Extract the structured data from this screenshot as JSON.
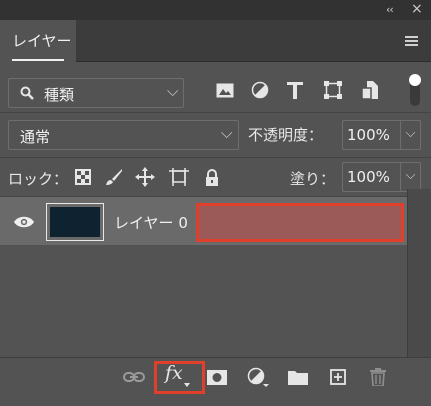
{
  "panel": {
    "collapse_glyph": "‹‹",
    "close_glyph": "×",
    "tab_label": "レイヤー",
    "menu_icon": "panel-menu-icon"
  },
  "filter": {
    "kind_label": "種類",
    "chevron": "⌵",
    "icons": [
      "image-filter-icon",
      "adjustment-filter-icon",
      "type-filter-icon",
      "shape-filter-icon",
      "smart-object-filter-icon"
    ]
  },
  "blend": {
    "mode": "通常",
    "chevron": "⌵",
    "opacity_label": "不透明度：",
    "opacity_value": "100%",
    "opacity_drop": "⌵"
  },
  "lock": {
    "label": "ロック：",
    "icons": [
      "lock-transparent-pixels-icon",
      "lock-image-pixels-icon",
      "lock-position-icon",
      "lock-artboard-icon",
      "lock-all-icon"
    ],
    "fill_label": "塗り：",
    "fill_value": "100%",
    "fill_drop": "⌵"
  },
  "layers": [
    {
      "name": "レイヤー 0",
      "visible": true,
      "thumbnail_color": "#0e2230"
    }
  ],
  "bottom": {
    "fx_label": "fx",
    "icons": [
      "link-layers-icon",
      "fx-icon",
      "add-mask-icon",
      "new-adjustment-layer-icon",
      "new-group-folder-icon",
      "new-layer-icon",
      "trash-icon"
    ]
  },
  "colors": {
    "panel_bg": "#535353",
    "selected_row": "#6a6a6a",
    "highlight_red": "#e0402b"
  }
}
